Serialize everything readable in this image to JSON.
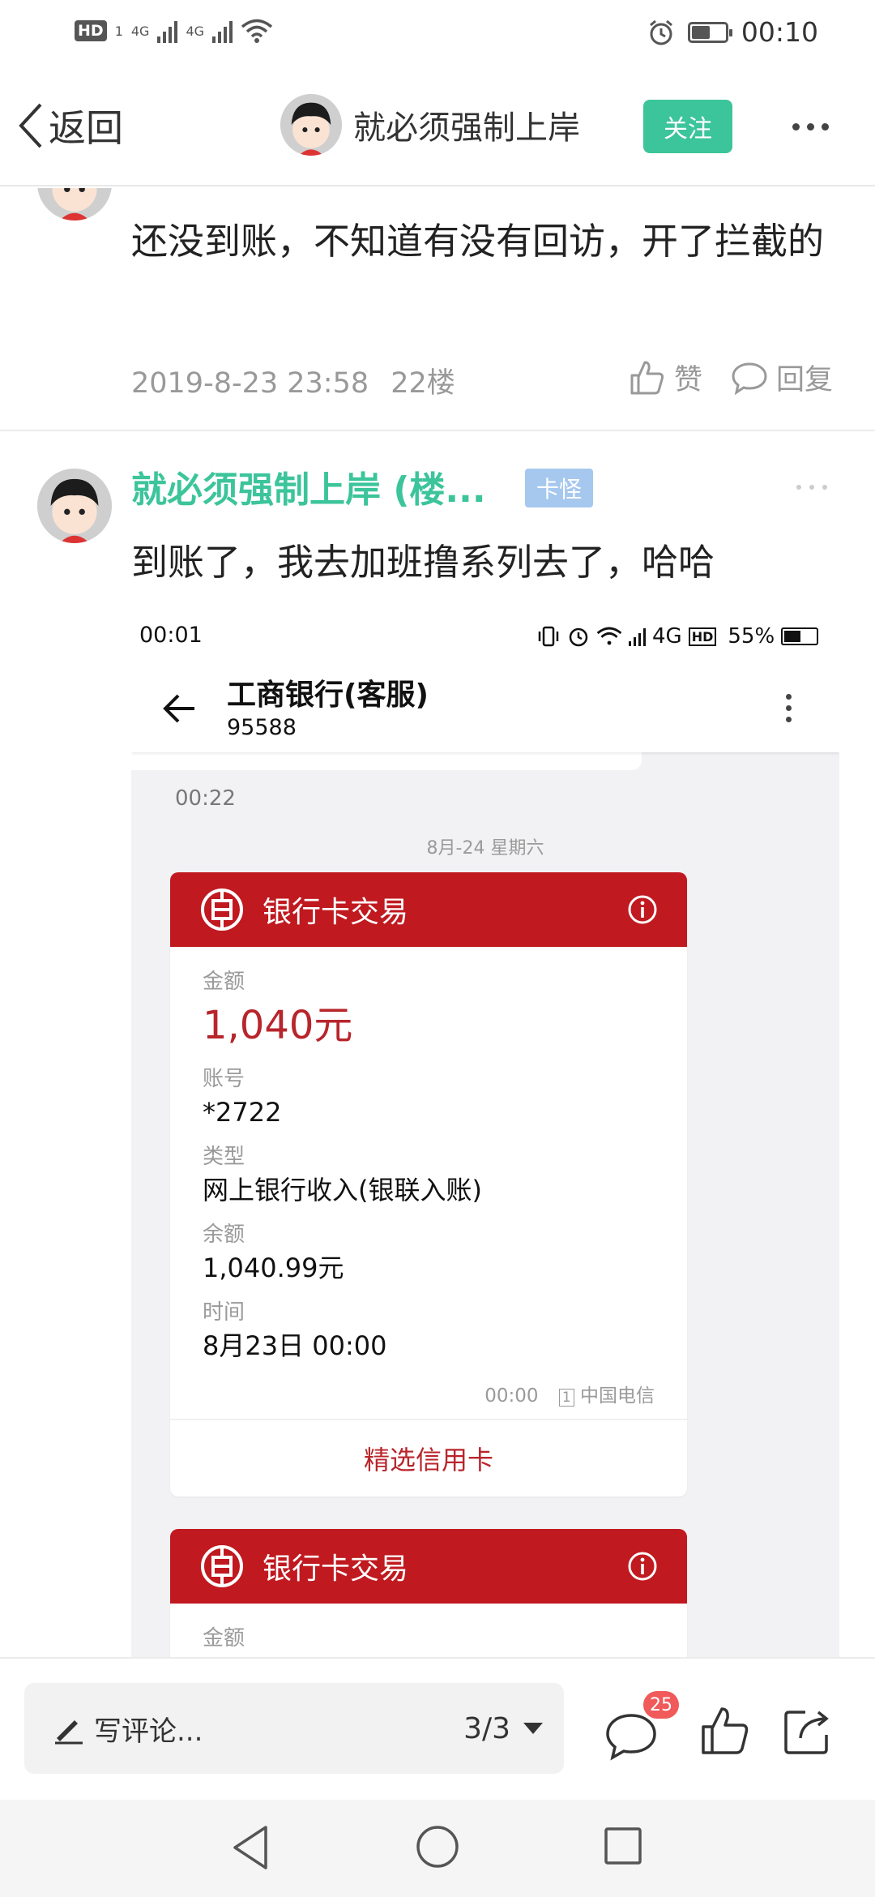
{
  "status_bar": {
    "hd_label": "HD",
    "sim1": "1",
    "net1": "4G",
    "net2": "4G",
    "time": "00:10"
  },
  "nav": {
    "back_label": "返回",
    "title": "就必须强制上岸",
    "follow_label": "关注"
  },
  "post_prev": {
    "text": "还没到账，不知道有没有回访，开了拦截的",
    "date": "2019-8-23 23:58",
    "floor": "22楼",
    "like_label": "赞",
    "reply_label": "回复"
  },
  "post_main": {
    "username": "就必须强制上岸 (楼...",
    "tag": "卡怪",
    "text": "到账了，我去加班撸系列去了，哈哈"
  },
  "embed": {
    "status_time": "00:01",
    "status_net": "4G",
    "status_hd": "HD",
    "battery_pct": "55%",
    "battery_level": 0.55,
    "chat_title": "工商银行(客服)",
    "chat_number": "95588",
    "prev_time": "00:22",
    "date_divider": "8月-24 星期六",
    "cards": [
      {
        "title": "银行卡交易",
        "amount_label": "金额",
        "amount": "1,040元",
        "account_label": "账号",
        "account": "*2722",
        "type_label": "类型",
        "type": "网上银行收入(银联入账)",
        "balance_label": "余额",
        "balance": "1,040.99元",
        "time_label": "时间",
        "time": "8月23日 00:00",
        "footer_time": "00:00",
        "sim_index": "1",
        "carrier": "中国电信",
        "link_label": "精选信用卡"
      },
      {
        "title": "银行卡交易",
        "amount_label": "金额"
      }
    ]
  },
  "bottom_bar": {
    "comment_placeholder": "写评论...",
    "page_indicator": "3/3",
    "comment_count": "25"
  },
  "colors": {
    "brand_green": "#3cc49a",
    "icbc_red": "#c0191f",
    "amount_red": "#b8252b",
    "badge_red": "#f05a5a",
    "tag_blue": "#a6c8ee"
  },
  "icons": [
    "back-chevron-icon",
    "more-icon",
    "like-icon",
    "reply-icon",
    "edit-icon",
    "comment-icon",
    "share-icon",
    "icbc-logo-icon",
    "info-icon",
    "nav-back-triangle-icon",
    "nav-home-circle-icon",
    "nav-recents-square-icon"
  ]
}
